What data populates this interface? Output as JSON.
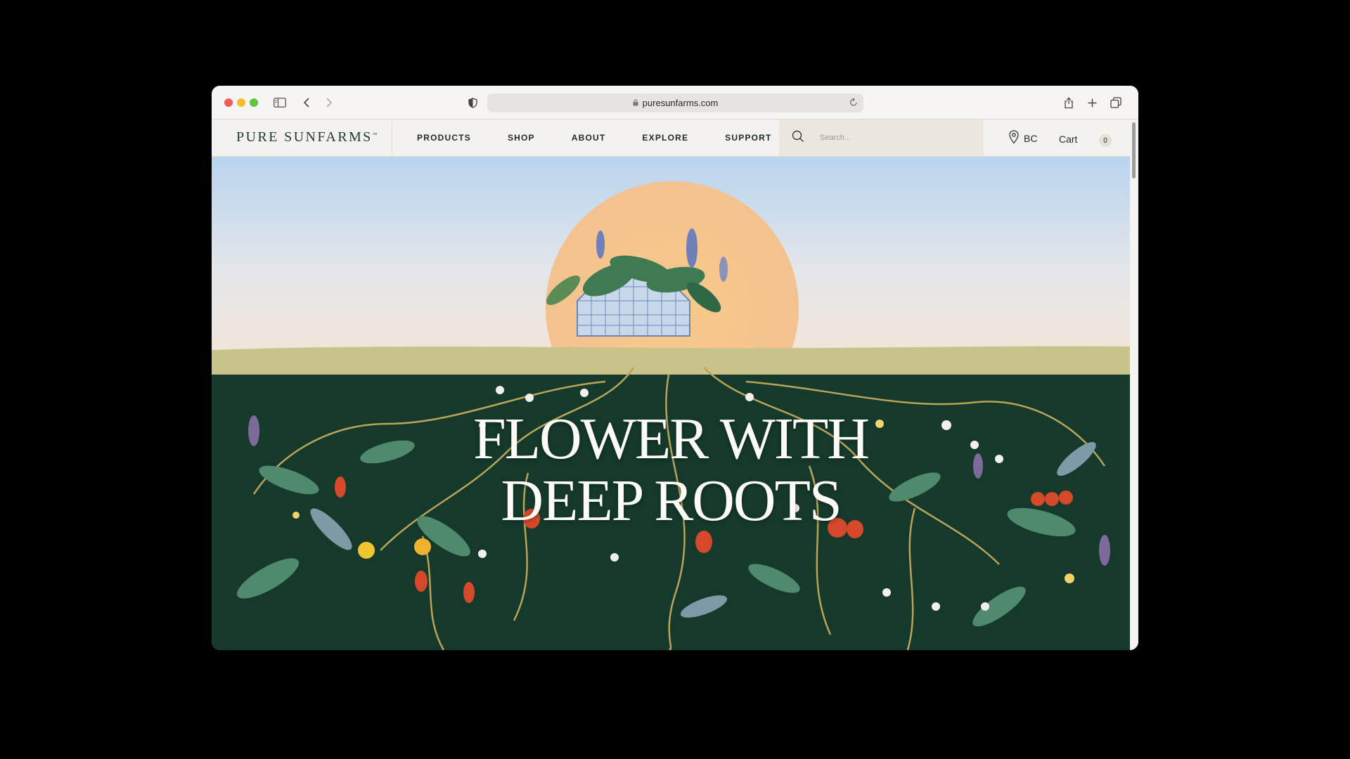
{
  "browser": {
    "url": "puresunfarms.com"
  },
  "header": {
    "logo": "PURE SUNFARMS",
    "logo_tm": "™",
    "nav": [
      "PRODUCTS",
      "SHOP",
      "ABOUT",
      "EXPLORE",
      "SUPPORT"
    ],
    "search_placeholder": "Search...",
    "region": "BC",
    "cart_label": "Cart",
    "cart_count": "0"
  },
  "hero": {
    "headline_line1": "FLOWER WITH",
    "headline_line2": "DEEP ROOTS"
  },
  "colors": {
    "sky": "#cfe0ef",
    "sun": "#f6c98f",
    "grass": "#c9c68c",
    "soil": "#153a2c",
    "brand_green": "#1f3a2f"
  },
  "icons": [
    "sidebar-icon",
    "back-icon",
    "forward-icon",
    "shield-icon",
    "lock-icon",
    "reload-icon",
    "share-icon",
    "new-tab-icon",
    "tabs-overview-icon",
    "search-icon",
    "location-pin-icon"
  ]
}
